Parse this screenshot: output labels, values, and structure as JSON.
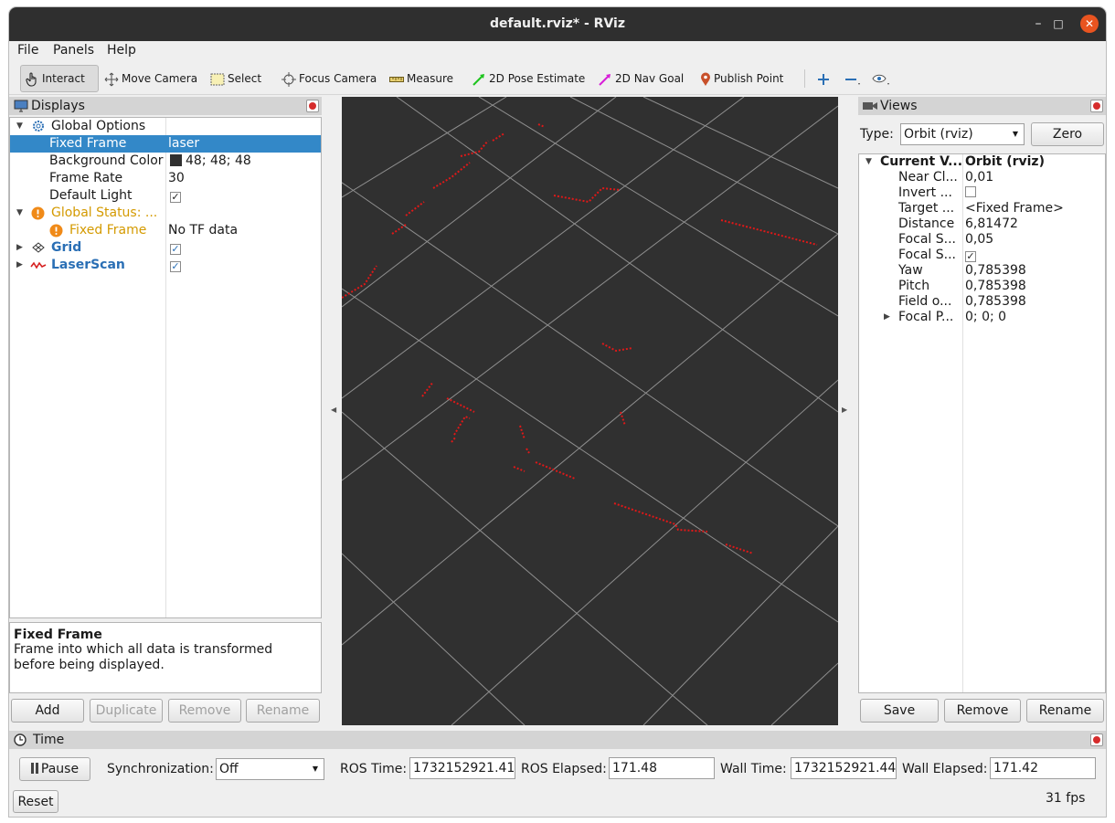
{
  "window": {
    "title": "default.rviz* - RViz"
  },
  "menu": {
    "file": "File",
    "panels": "Panels",
    "help": "Help"
  },
  "toolbar": {
    "interact": "Interact",
    "move_camera": "Move Camera",
    "select": "Select",
    "focus_camera": "Focus Camera",
    "measure": "Measure",
    "pose_estimate": "2D Pose Estimate",
    "nav_goal": "2D Nav Goal",
    "publish_point": "Publish Point"
  },
  "displays": {
    "title": "Displays",
    "rows": {
      "global_options": "Global Options",
      "fixed_frame": {
        "label": "Fixed Frame",
        "value": "laser"
      },
      "background_color": {
        "label": "Background Color",
        "value": "48; 48; 48"
      },
      "frame_rate": {
        "label": "Frame Rate",
        "value": "30"
      },
      "default_light": {
        "label": "Default Light"
      },
      "global_status": "Global Status: ...",
      "status_fixed_frame": {
        "label": "Fixed Frame",
        "value": "No TF data"
      },
      "grid": "Grid",
      "laserscan": "LaserScan"
    },
    "help_title": "Fixed Frame",
    "help_text": "Frame into which all data is transformed before being displayed.",
    "buttons": {
      "add": "Add",
      "duplicate": "Duplicate",
      "remove": "Remove",
      "rename": "Rename"
    }
  },
  "views": {
    "title": "Views",
    "type_label": "Type:",
    "type_value": "Orbit (rviz)",
    "zero": "Zero",
    "rows": {
      "current_view": {
        "label": "Current V...",
        "value": "Orbit (rviz)"
      },
      "near_clip": {
        "label": "Near Cl...",
        "value": "0,01"
      },
      "invert": {
        "label": "Invert ..."
      },
      "target": {
        "label": "Target ...",
        "value": "<Fixed Frame>"
      },
      "distance": {
        "label": "Distance",
        "value": "6,81472"
      },
      "focal_shape_size": {
        "label": "Focal S...",
        "value": "0,05"
      },
      "focal_shape_fixed": {
        "label": "Focal S..."
      },
      "yaw": {
        "label": "Yaw",
        "value": "0,785398"
      },
      "pitch": {
        "label": "Pitch",
        "value": "0,785398"
      },
      "field_of_view": {
        "label": "Field o...",
        "value": "0,785398"
      },
      "focal_point": {
        "label": "Focal P...",
        "value": "0; 0; 0"
      }
    },
    "buttons": {
      "save": "Save",
      "remove": "Remove",
      "rename": "Rename"
    }
  },
  "time": {
    "title": "Time",
    "pause": "Pause",
    "sync_label": "Synchronization:",
    "sync_value": "Off",
    "ros_time_label": "ROS Time:",
    "ros_time": "1732152921.41",
    "ros_elapsed_label": "ROS Elapsed:",
    "ros_elapsed": "171.48",
    "wall_time_label": "Wall Time:",
    "wall_time": "1732152921.44",
    "wall_elapsed_label": "Wall Elapsed:",
    "wall_elapsed": "171.42",
    "reset": "Reset",
    "fps": "31 fps"
  },
  "colors": {
    "accent": "#e95420",
    "selection": "#3388c8",
    "status_warn": "#d49a00",
    "laser": "#e01818",
    "viewport_bg": "#303030",
    "link_blue": "#2a6fb5"
  }
}
